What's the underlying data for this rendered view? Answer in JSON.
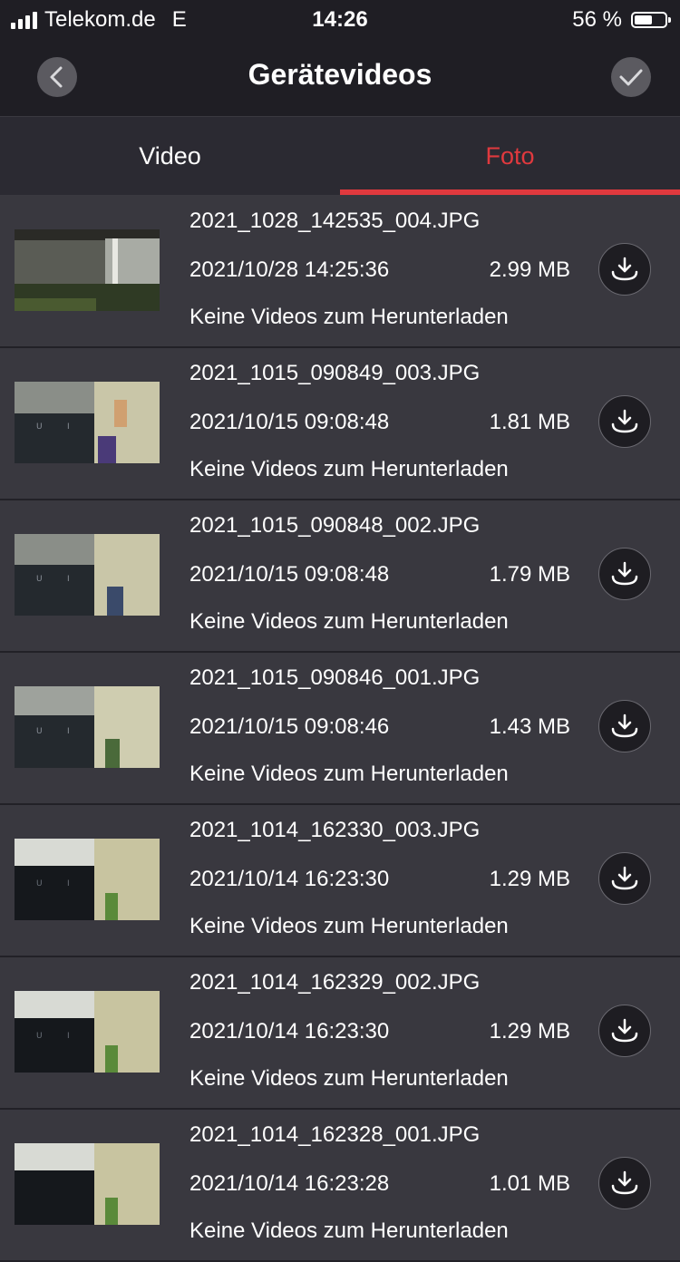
{
  "status_bar": {
    "carrier": "Telekom.de",
    "network": "E",
    "time": "14:26",
    "battery": "56 %",
    "battery_level_percent": 56,
    "signal_bars": 4
  },
  "header": {
    "title": "Gerätevideos",
    "back_icon": "chevron-left-icon",
    "confirm_icon": "checkmark-icon"
  },
  "tabs": [
    {
      "label": "Video",
      "active": false
    },
    {
      "label": "Foto",
      "active": true
    }
  ],
  "colors": {
    "accent": "#e0393e",
    "background": "#2b2a32",
    "row": "#39383f",
    "bar": "#1f1e24"
  },
  "files": [
    {
      "name": "2021_1028_142535_004.JPG",
      "datetime": "2021/10/28 14:25:36",
      "size": "2.99 MB",
      "status": "Keine Videos zum Herunterladen"
    },
    {
      "name": "2021_1015_090849_003.JPG",
      "datetime": "2021/10/15 09:08:48",
      "size": "1.81 MB",
      "status": "Keine Videos zum Herunterladen"
    },
    {
      "name": "2021_1015_090848_002.JPG",
      "datetime": "2021/10/15 09:08:48",
      "size": "1.79 MB",
      "status": "Keine Videos zum Herunterladen"
    },
    {
      "name": "2021_1015_090846_001.JPG",
      "datetime": "2021/10/15 09:08:46",
      "size": "1.43 MB",
      "status": "Keine Videos zum Herunterladen"
    },
    {
      "name": "2021_1014_162330_003.JPG",
      "datetime": "2021/10/14 16:23:30",
      "size": "1.29 MB",
      "status": "Keine Videos zum Herunterladen"
    },
    {
      "name": "2021_1014_162329_002.JPG",
      "datetime": "2021/10/14 16:23:30",
      "size": "1.29 MB",
      "status": "Keine Videos zum Herunterladen"
    },
    {
      "name": "2021_1014_162328_001.JPG",
      "datetime": "2021/10/14 16:23:28",
      "size": "1.01 MB",
      "status": "Keine Videos zum Herunterladen"
    }
  ]
}
